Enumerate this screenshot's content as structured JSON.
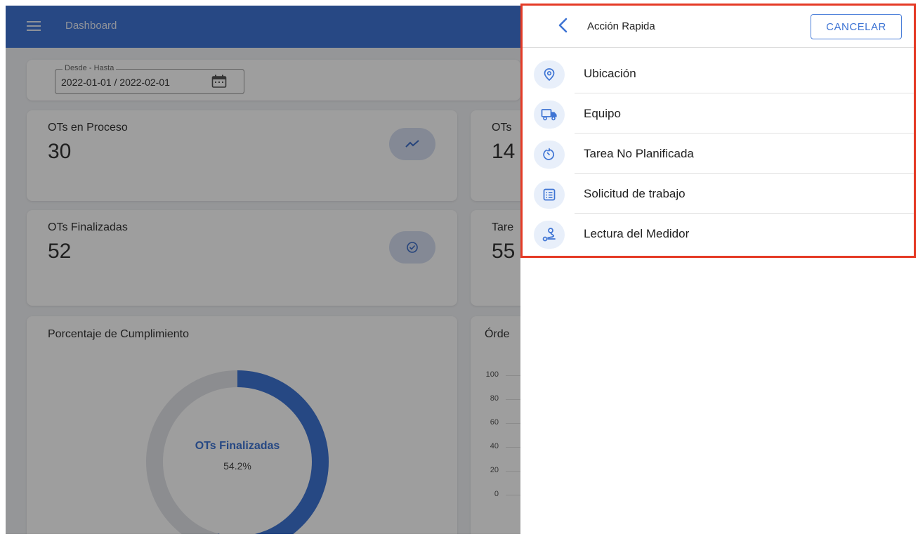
{
  "appbar": {
    "title": "Dashboard"
  },
  "date_filter": {
    "legend": "Desde - Hasta",
    "value": "2022-01-01 / 2022-02-01"
  },
  "cards": {
    "en_proceso": {
      "label": "OTs en Proceso",
      "value": "30"
    },
    "finalizadas": {
      "label": "OTs Finalizadas",
      "value": "52"
    },
    "partial_top_label": "OTs",
    "partial_top_value": "14",
    "partial_mid_label": "Tare",
    "partial_mid_value": "55"
  },
  "compliance": {
    "title": "Porcentaje de Cumplimiento",
    "center_label": "OTs Finalizadas",
    "center_value": "54.2%",
    "percent": 54.2
  },
  "orders_chart": {
    "title_partial": "Órde",
    "y_ticks": [
      "100",
      "80",
      "60",
      "40",
      "20",
      "0"
    ]
  },
  "quick_action": {
    "title": "Acción Rapida",
    "cancel_label": "CANCELAR",
    "items": [
      {
        "label": "Ubicación",
        "icon": "location-pin-icon"
      },
      {
        "label": "Equipo",
        "icon": "truck-icon"
      },
      {
        "label": "Tarea No Planificada",
        "icon": "timer-icon"
      },
      {
        "label": "Solicitud de trabajo",
        "icon": "request-form-icon"
      },
      {
        "label": "Lectura del Medidor",
        "icon": "route-meter-icon"
      }
    ]
  },
  "colors": {
    "primary": "#3f74d6",
    "highlight": "#e53b26",
    "icon_bg": "#e8effa"
  }
}
